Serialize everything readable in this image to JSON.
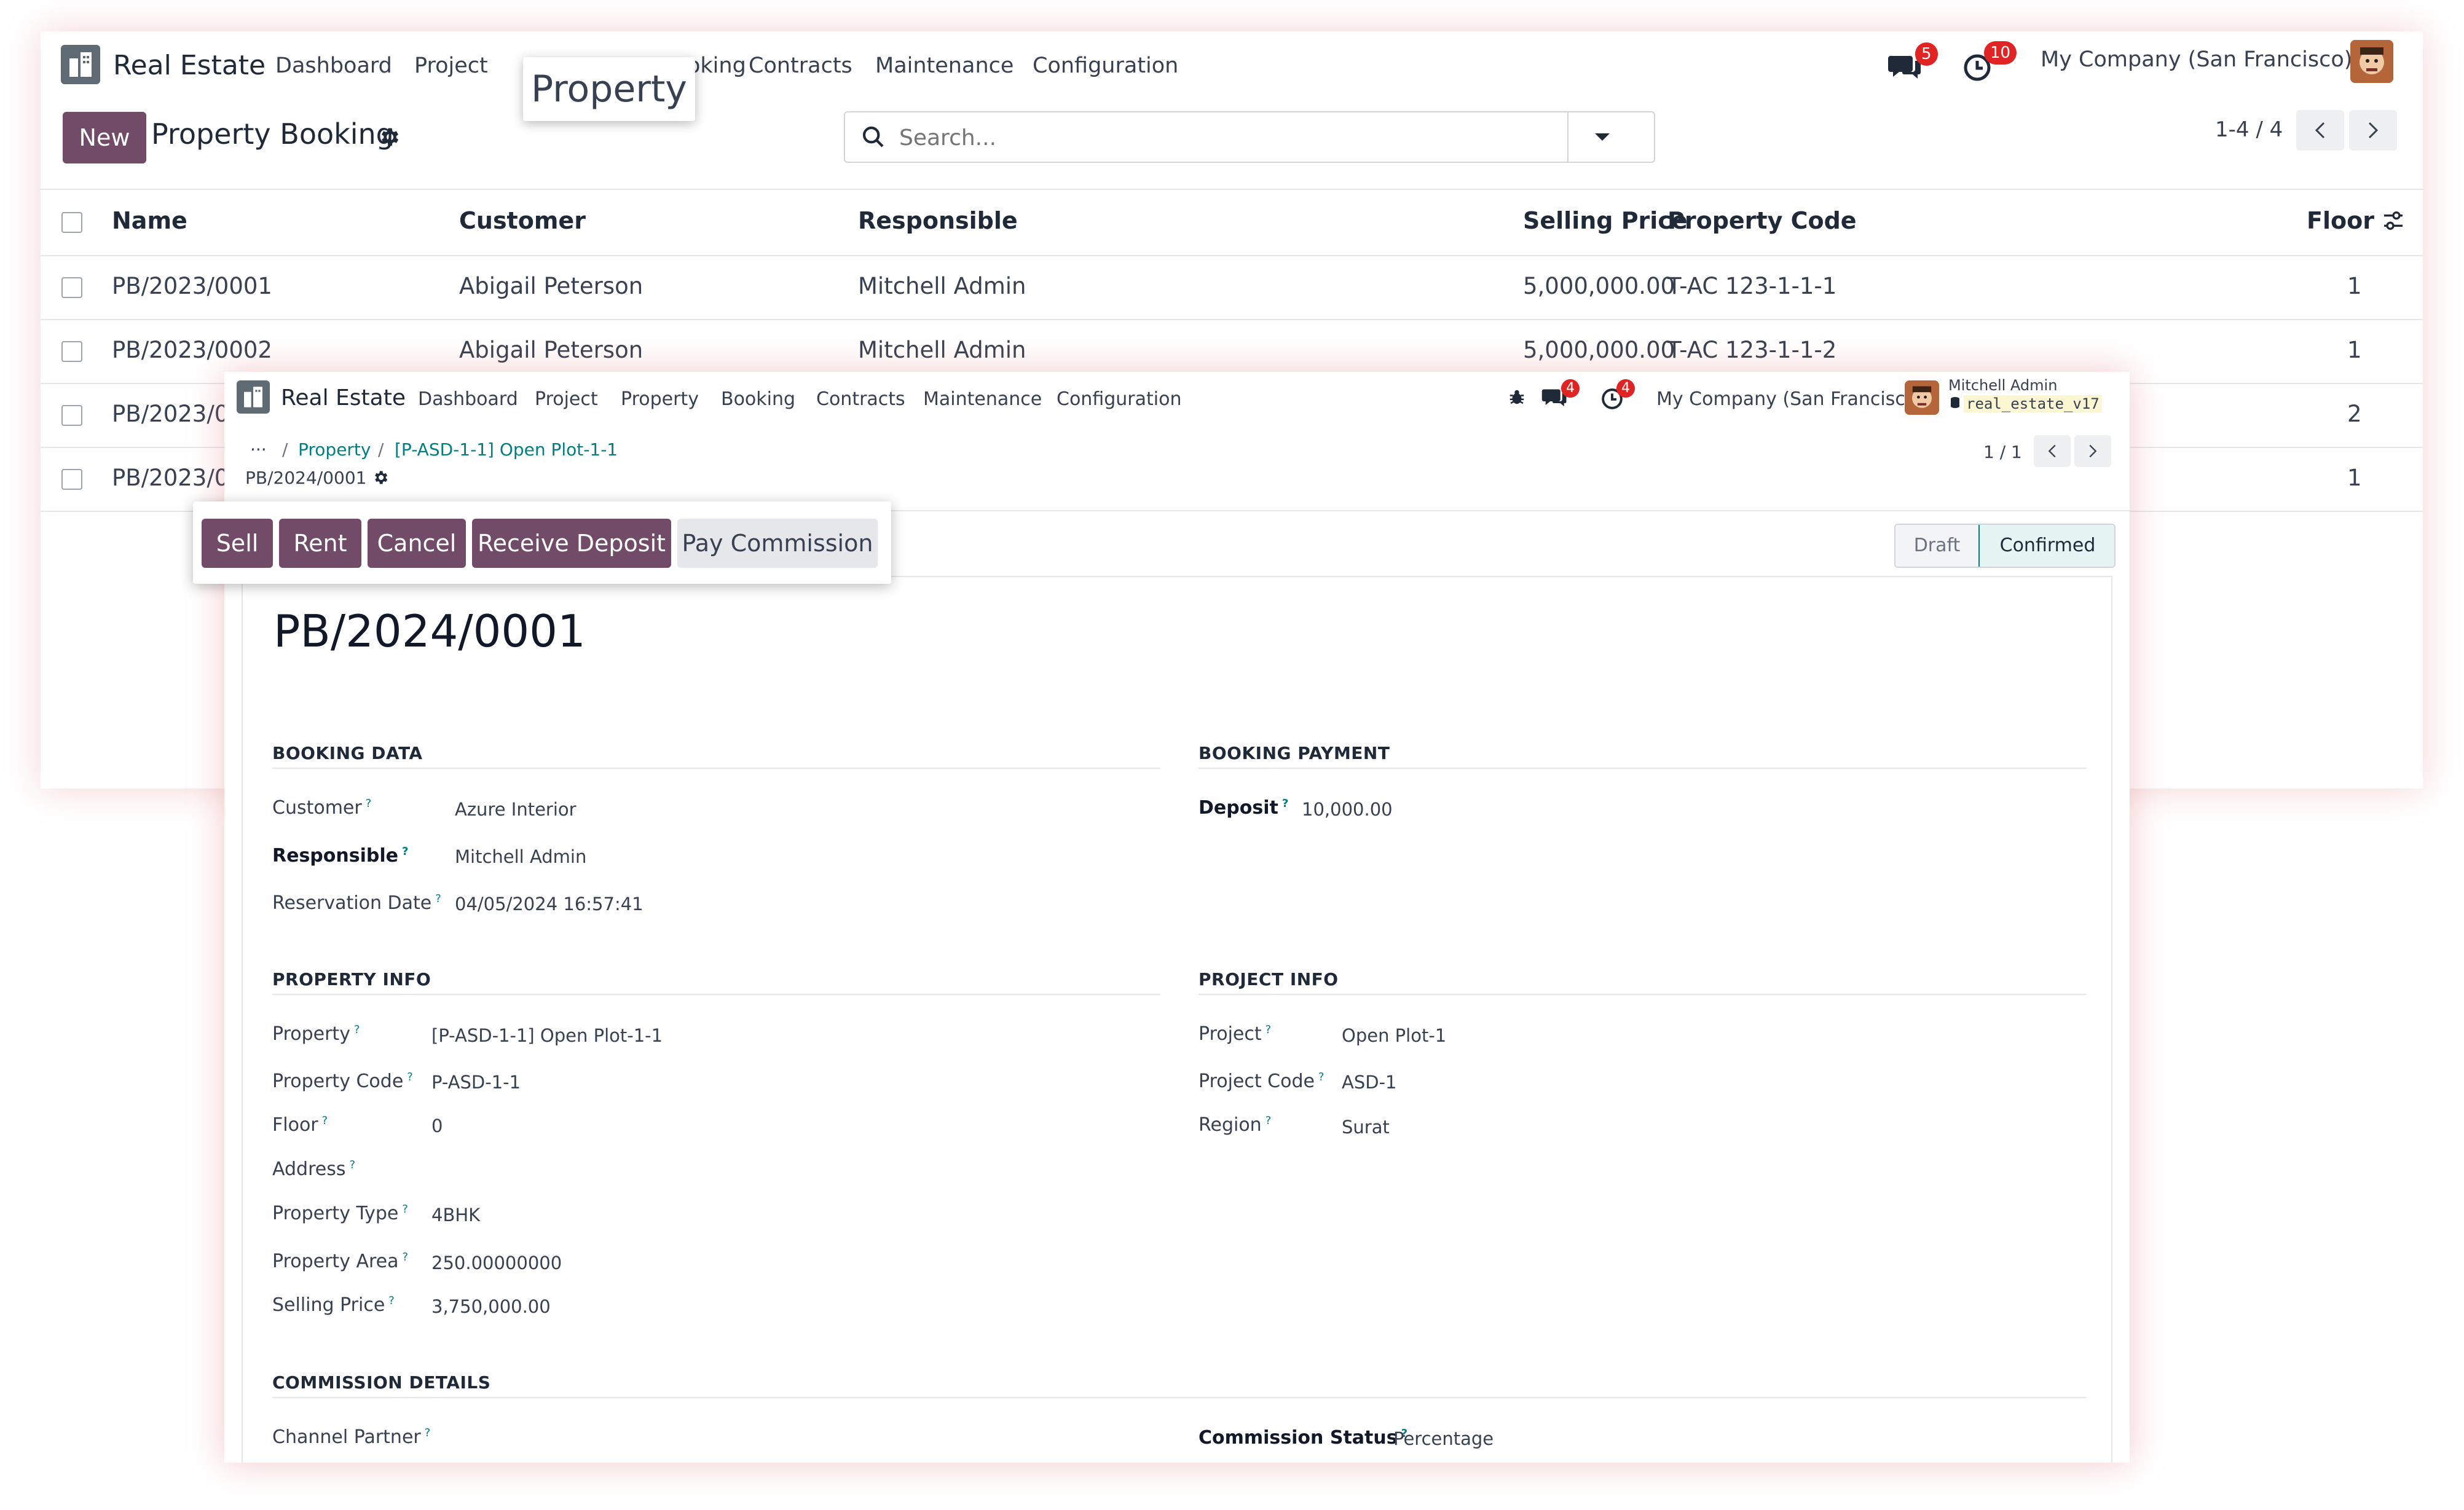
{
  "back_window": {
    "app_name": "Real Estate",
    "menu": [
      "Dashboard",
      "Project",
      "Booking",
      "Contracts",
      "Maintenance",
      "Configuration"
    ],
    "menu_booking_partial": "oking",
    "tooltip": "Property",
    "messages_count": "5",
    "activities_count": "10",
    "company": "My Company (San Francisco)",
    "new_label": "New",
    "title": "Property Booking",
    "search_placeholder": "Search...",
    "pager": "1-4 / 4",
    "columns": [
      "Name",
      "Customer",
      "Responsible",
      "Selling Price",
      "Property Code",
      "Floor"
    ],
    "rows": [
      {
        "name": "PB/2023/0001",
        "customer": "Abigail Peterson",
        "responsible": "Mitchell Admin",
        "price": "5,000,000.00",
        "code": "T-AC 123-1-1-1",
        "floor": "1"
      },
      {
        "name": "PB/2023/0002",
        "customer": "Abigail Peterson",
        "responsible": "Mitchell Admin",
        "price": "5,000,000.00",
        "code": "T-AC 123-1-1-2",
        "floor": "1"
      },
      {
        "name": "PB/2023/0",
        "customer": "",
        "responsible": "",
        "price": "",
        "code": "",
        "floor": "2"
      },
      {
        "name": "PB/2023/0",
        "customer": "",
        "responsible": "",
        "price": "",
        "code": "",
        "floor": "1"
      }
    ]
  },
  "front_window": {
    "app_name": "Real Estate",
    "menu": [
      "Dashboard",
      "Project",
      "Property",
      "Booking",
      "Contracts",
      "Maintenance",
      "Configuration"
    ],
    "messages_count": "4",
    "activities_count": "4",
    "company": "My Company (San Francisco)",
    "user_name": "Mitchell Admin",
    "db_name": "real_estate_v17",
    "breadcrumb": [
      "Property",
      "[P-ASD-1-1] Open Plot-1-1"
    ],
    "breadcrumb_ellipsis": "···",
    "record_ref": "PB/2024/0001",
    "pager": "1 / 1",
    "actions": [
      "Sell",
      "Rent",
      "Cancel",
      "Receive Deposit",
      "Pay Commission"
    ],
    "status": [
      "Draft",
      "Confirmed"
    ],
    "record_title": "PB/2024/0001",
    "sections": {
      "booking_data": {
        "title": "BOOKING DATA",
        "customer_label": "Customer",
        "customer": "Azure Interior",
        "responsible_label": "Responsible",
        "responsible": "Mitchell Admin",
        "reservation_label": "Reservation Date",
        "reservation": "04/05/2024 16:57:41"
      },
      "booking_payment": {
        "title": "BOOKING PAYMENT",
        "deposit_label": "Deposit",
        "deposit": "10,000.00"
      },
      "property_info": {
        "title": "PROPERTY INFO",
        "property_label": "Property",
        "property": "[P-ASD-1-1] Open Plot-1-1",
        "code_label": "Property Code",
        "code": "P-ASD-1-1",
        "floor_label": "Floor",
        "floor": "0",
        "address_label": "Address",
        "type_label": "Property Type",
        "type": "4BHK",
        "area_label": "Property Area",
        "area": "250.00000000",
        "price_label": "Selling Price",
        "price": "3,750,000.00"
      },
      "project_info": {
        "title": "PROJECT INFO",
        "project_label": "Project",
        "project": "Open Plot-1",
        "pcode_label": "Project Code",
        "pcode": "ASD-1",
        "region_label": "Region",
        "region": "Surat"
      },
      "commission": {
        "title": "COMMISSION DETAILS",
        "partner_label": "Channel Partner",
        "status_label": "Commission Status",
        "status": "Percentage"
      }
    },
    "help_mark": "?"
  },
  "colors": {
    "primary": "#714b67",
    "link": "#017e84",
    "badge": "#e02424"
  }
}
